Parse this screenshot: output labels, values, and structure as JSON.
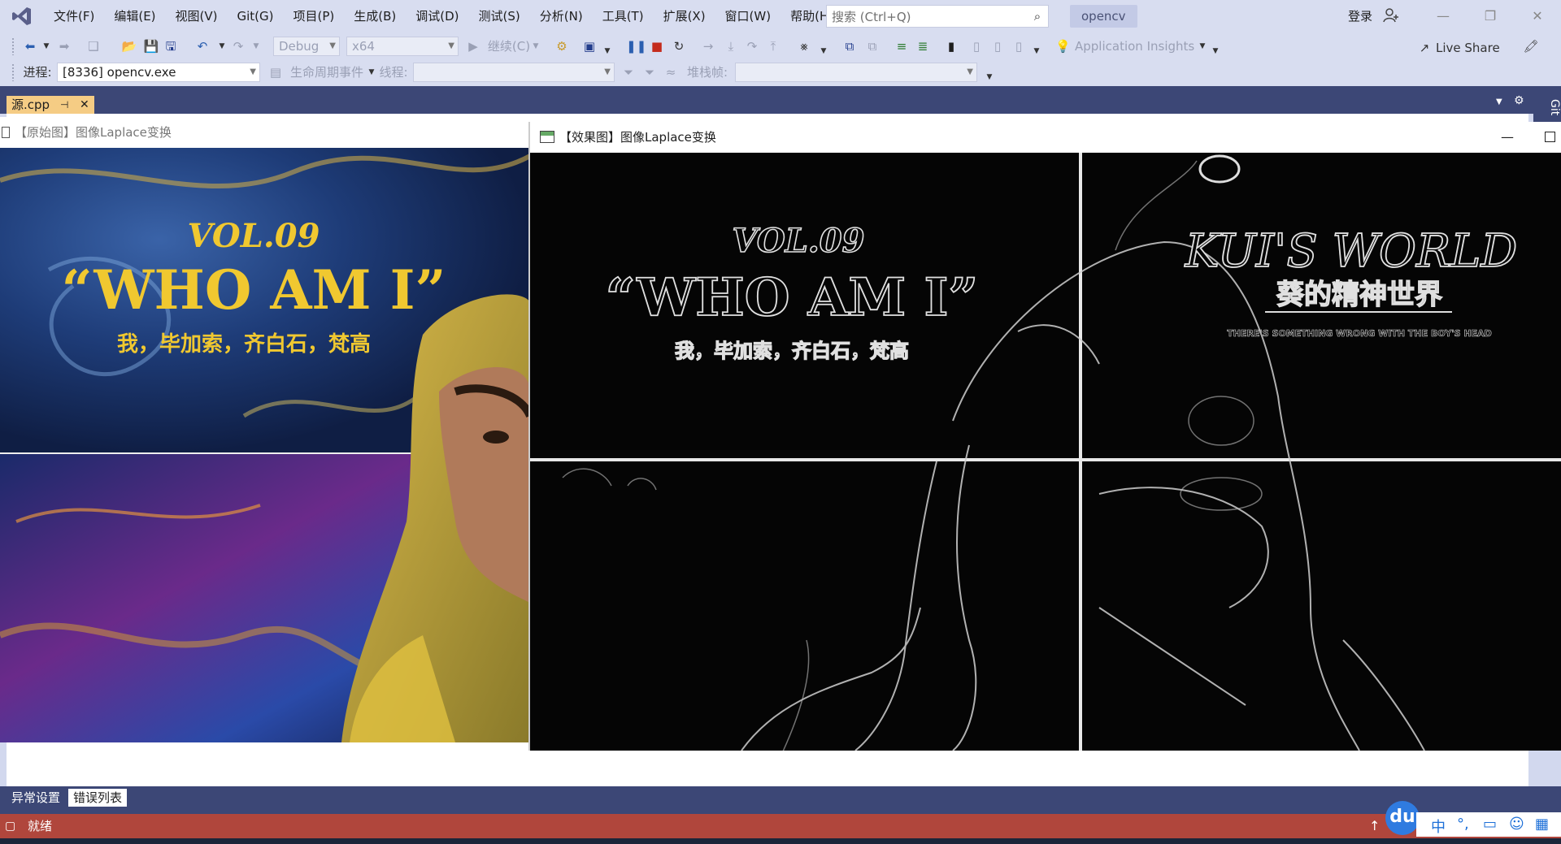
{
  "menubar": {
    "items": [
      "文件(F)",
      "编辑(E)",
      "视图(V)",
      "Git(G)",
      "项目(P)",
      "生成(B)",
      "调试(D)",
      "测试(S)",
      "分析(N)",
      "工具(T)",
      "扩展(X)",
      "窗口(W)",
      "帮助(H)"
    ],
    "search_placeholder": "搜索 (Ctrl+Q)",
    "solution_name": "opencv",
    "login_label": "登录"
  },
  "toolbar": {
    "config": "Debug",
    "platform": "x64",
    "continue_label": "继续(C)",
    "app_insights": "Application Insights",
    "live_share": "Live Share"
  },
  "debug_bar": {
    "process_label": "进程:",
    "process_value": "[8336] opencv.exe",
    "lifecycle_label": "生命周期事件",
    "thread_label": "线程:",
    "stackframe_label": "堆栈帧:"
  },
  "doc_tab": {
    "name": "源.cpp"
  },
  "side_tab": "Git",
  "orig_window": {
    "title": "【原始图】图像Laplace变换",
    "vol": "VOL.09",
    "headline": "“WHO AM I”",
    "subtitle": "我，毕加索，齐白石，梵高"
  },
  "result_window": {
    "title": "【效果图】图像Laplace变换",
    "vol": "VOL.09",
    "headline": "“WHO AM I”",
    "subtitle": "我，毕加索，齐白石，梵高",
    "brand": "KUI'S WORLD",
    "brand_cn": "葵的精神世界",
    "brand_tagline": "THERE'S SOMETHING WRONG WITH THE BOY'S HEAD"
  },
  "bottom_tabs": [
    "异常设置",
    "错误列表"
  ],
  "status": {
    "text": "就绪"
  },
  "ime": {
    "badge": "du",
    "lang": "中"
  }
}
